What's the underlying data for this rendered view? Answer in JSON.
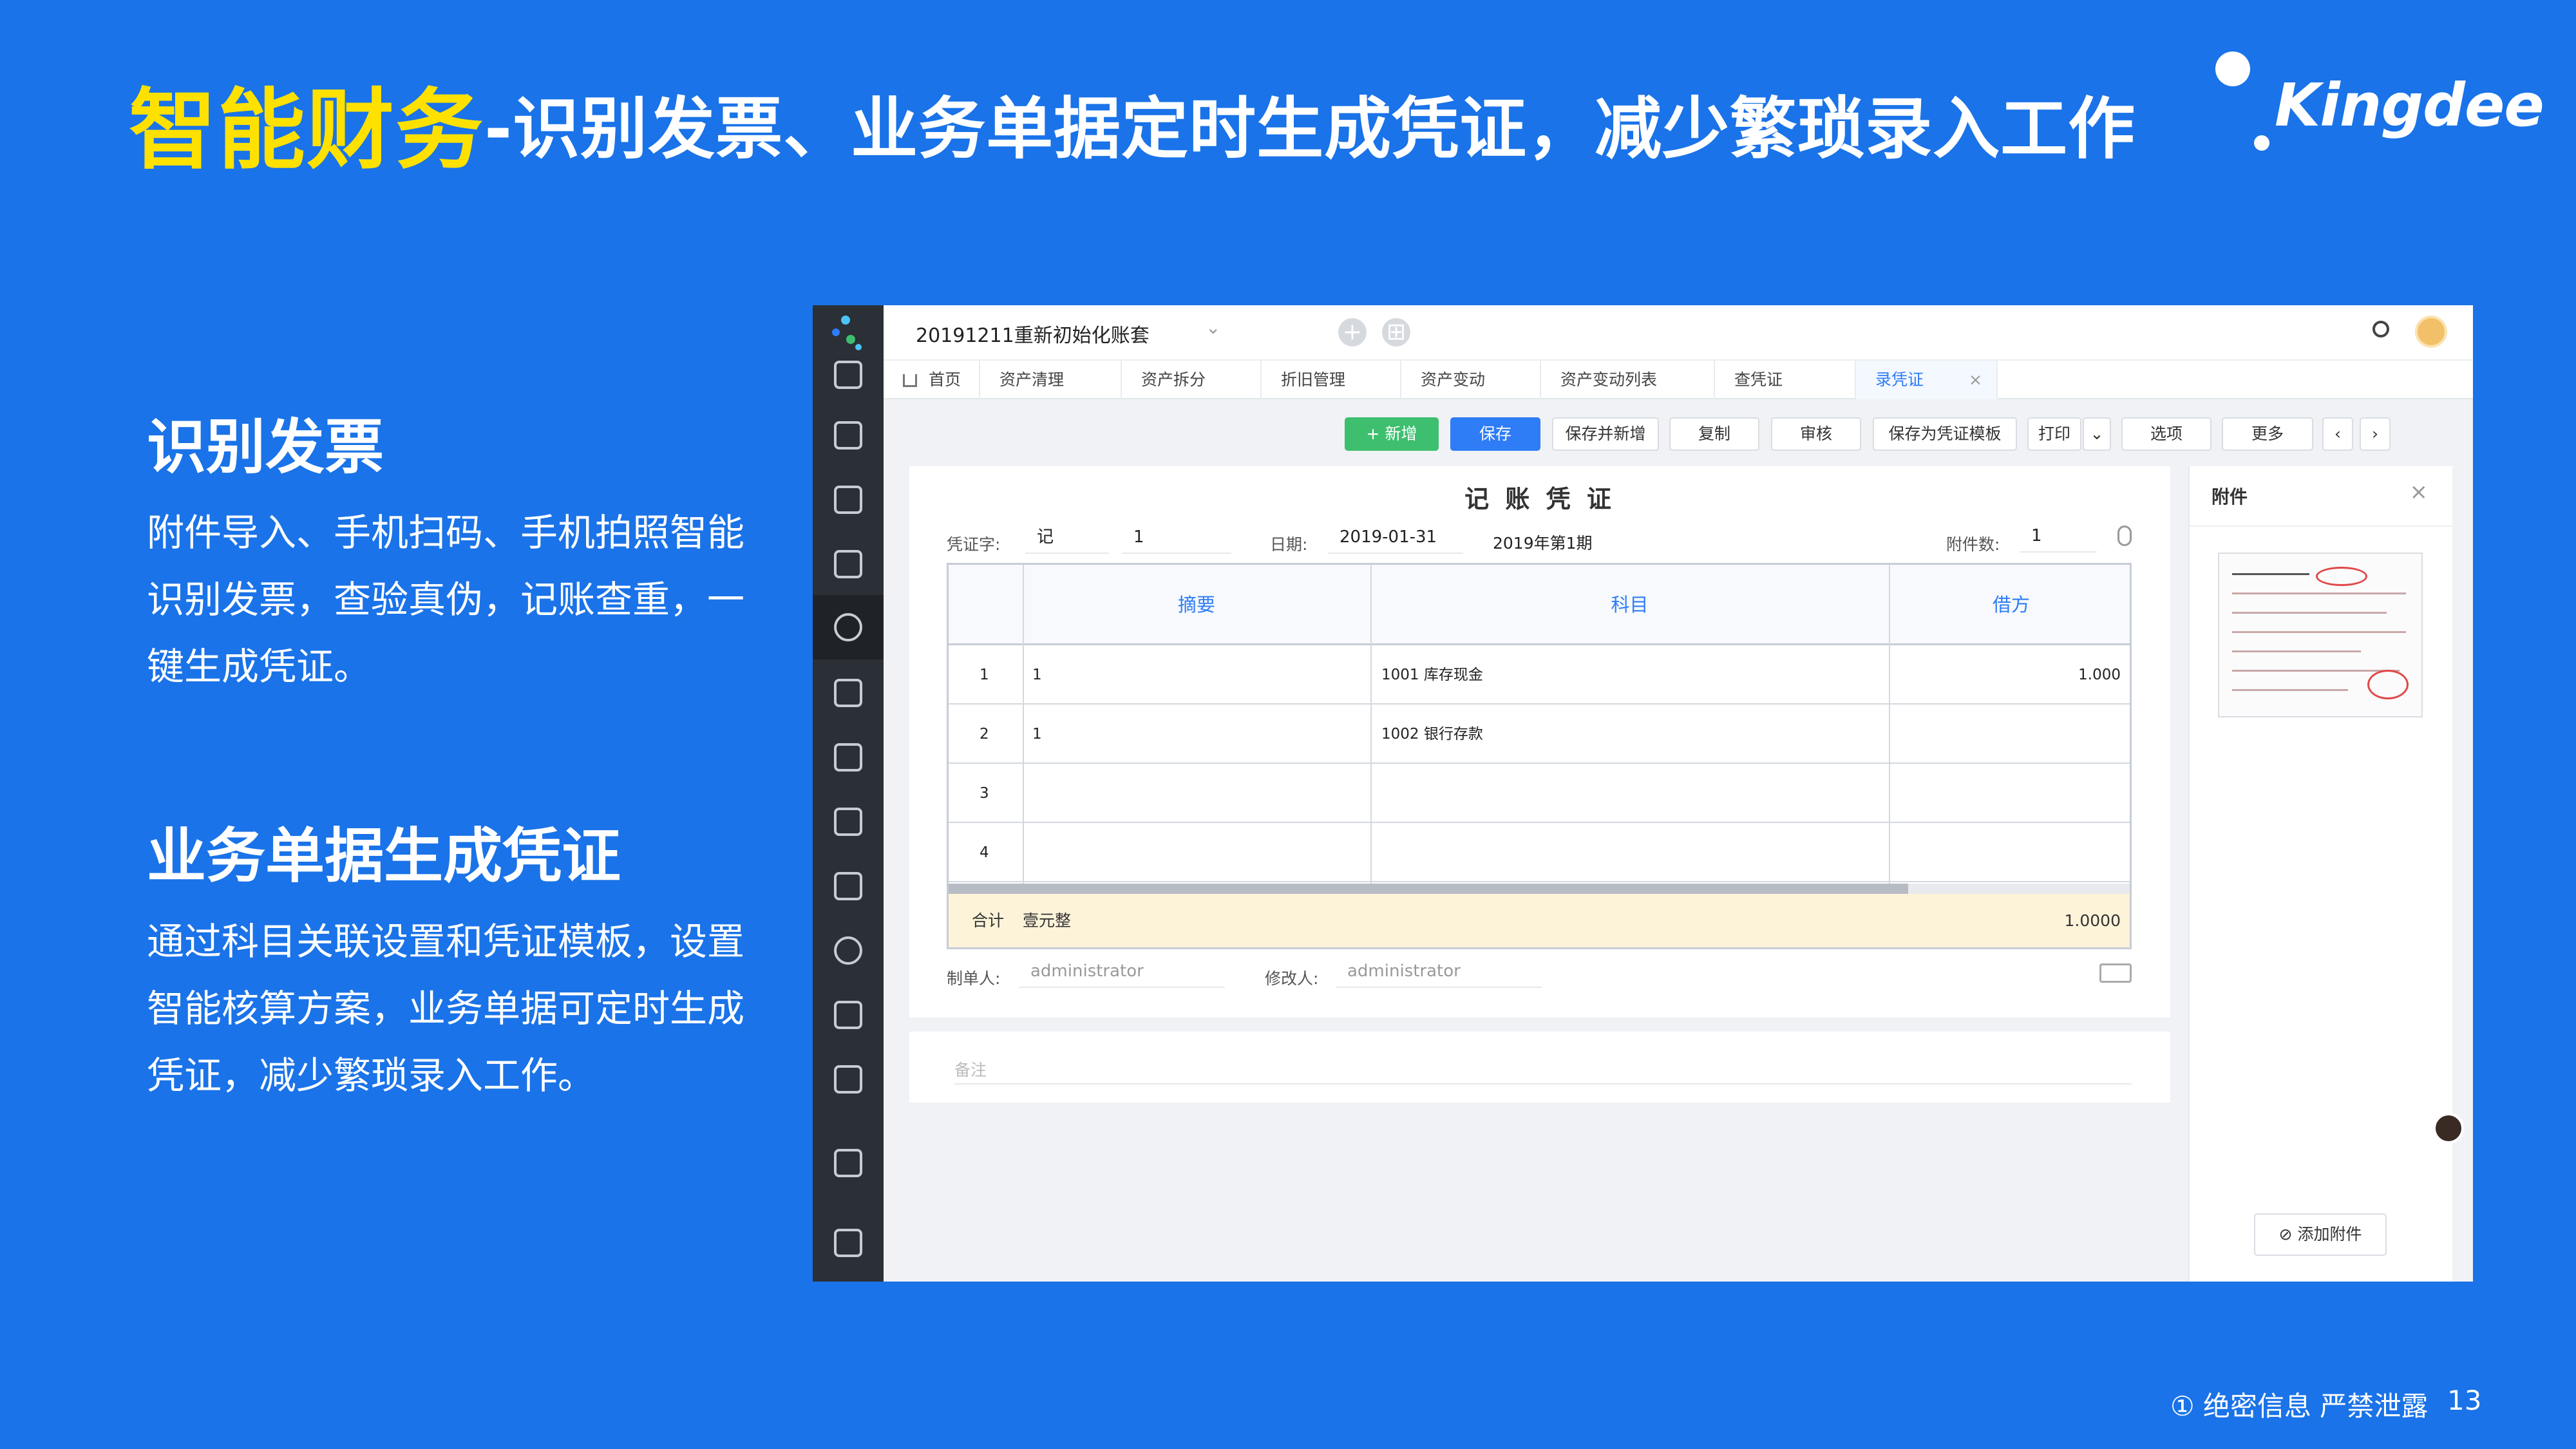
{
  "slide": {
    "title_highlight": "智能财务",
    "title_rest": "-识别发票、业务单据定时生成凭证，减少繁琐录入工作",
    "logo_text": "Kingdee",
    "sections": [
      {
        "heading": "识别发票",
        "body": "附件导入、手机扫码、手机拍照智能识别发票，查验真伪，记账查重，一键生成凭证。"
      },
      {
        "heading": "业务单据生成凭证",
        "body": "通过科目关联设置和凭证模板，设置智能核算方案，业务单据可定时生成凭证，减少繁琐录入工作。"
      }
    ],
    "footer_note": "① 绝密信息 严禁泄露",
    "page_number": "13"
  },
  "app": {
    "account_name": "20191211重新初始化账套",
    "tabs": [
      {
        "label": "首页"
      },
      {
        "label": "资产清理"
      },
      {
        "label": "资产拆分"
      },
      {
        "label": "折旧管理"
      },
      {
        "label": "资产变动"
      },
      {
        "label": "资产变动列表"
      },
      {
        "label": "查凭证"
      },
      {
        "label": "录凭证"
      }
    ],
    "toolbar": {
      "add": "+ 新增",
      "save": "保存",
      "save_and_new": "保存并新增",
      "copy": "复制",
      "audit": "审核",
      "save_as_template": "保存为凭证模板",
      "print": "打印",
      "options": "选项",
      "more": "更多"
    },
    "voucher": {
      "title": "记 账 凭 证",
      "word_label": "凭证字:",
      "word_value": "记",
      "number_value": "1",
      "date_label": "日期:",
      "date_value": "2019-01-31",
      "period_value": "2019年第1期",
      "attach_count_label": "附件数:",
      "attach_count_value": "1",
      "columns": {
        "summary": "摘要",
        "account": "科目",
        "debit": "借方"
      },
      "rows": [
        {
          "no": "1",
          "summary": "1",
          "account": "1001 库存现金",
          "debit": "1.000"
        },
        {
          "no": "2",
          "summary": "1",
          "account": "1002 银行存款",
          "debit": ""
        },
        {
          "no": "3",
          "summary": "",
          "account": "",
          "debit": ""
        },
        {
          "no": "4",
          "summary": "",
          "account": "",
          "debit": ""
        }
      ],
      "total_label": "合计",
      "total_words": "壹元整",
      "total_value": "1.0000",
      "maker_label": "制单人:",
      "maker_value": "administrator",
      "modifier_label": "修改人:",
      "modifier_value": "administrator",
      "remark_placeholder": "备注"
    },
    "attachment_panel": {
      "title": "附件",
      "close": "×",
      "add_button": "添加附件"
    }
  }
}
